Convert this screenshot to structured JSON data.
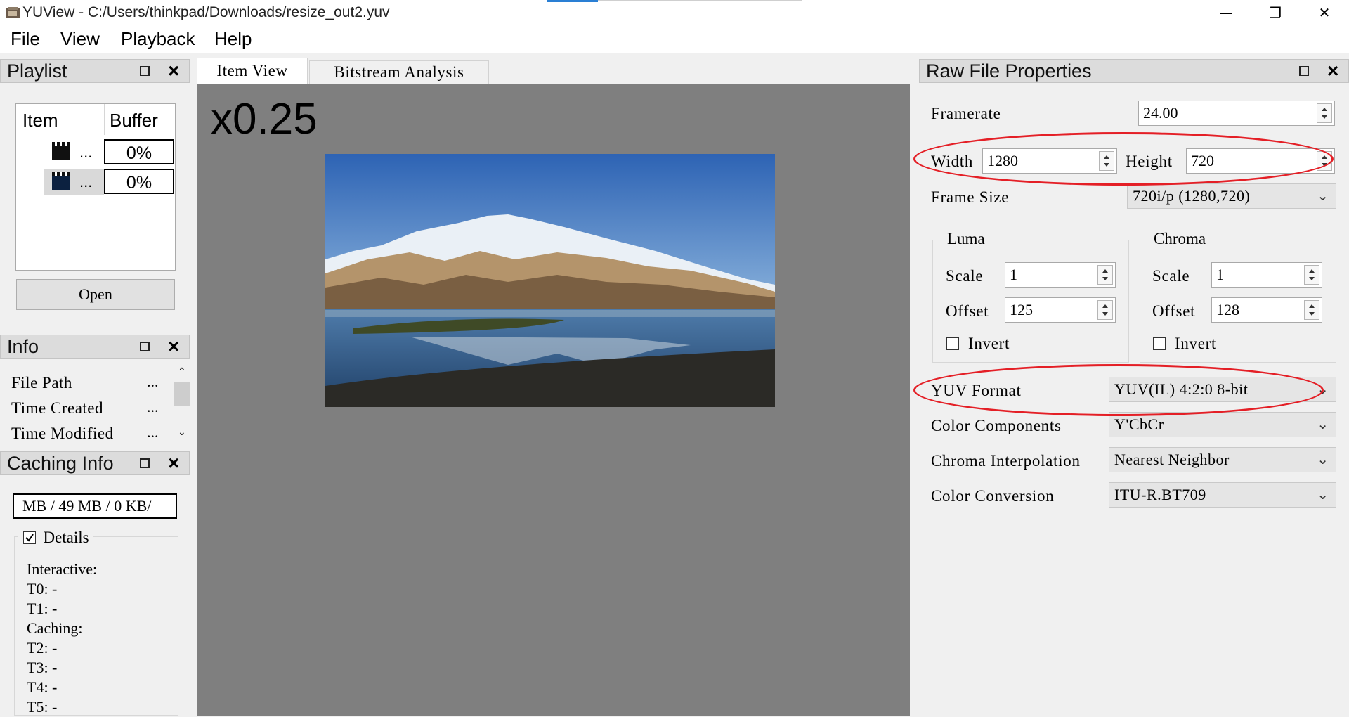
{
  "window": {
    "title": "YUView - C:/Users/thinkpad/Downloads/resize_out2.yuv",
    "minimize_symbol": "—",
    "restore_symbol": "❐",
    "close_symbol": "✕"
  },
  "menu": [
    "File",
    "View",
    "Playback",
    "Help"
  ],
  "playlist": {
    "title": "Playlist",
    "col_item": "Item",
    "col_buffer": "Buffer",
    "items": [
      {
        "name": "...",
        "buffer": "0%"
      },
      {
        "name": "...",
        "buffer": "0%"
      }
    ],
    "open_label": "Open"
  },
  "info": {
    "title": "Info",
    "rows": [
      {
        "label": "File Path",
        "value": "..."
      },
      {
        "label": "Time Created",
        "value": "..."
      },
      {
        "label": "Time Modified",
        "value": "..."
      }
    ]
  },
  "caching": {
    "title": "Caching Info",
    "summary": "MB / 49 MB / 0 KB/",
    "details_label": "Details",
    "details_checked": true,
    "lines": [
      "Interactive:",
      "T0: -",
      "T1: -",
      "Caching:",
      "T2: -",
      "T3: -",
      "T4: -",
      "T5: -"
    ]
  },
  "tabs": [
    "Item View",
    "Bitstream Analysis"
  ],
  "viewer": {
    "zoom": "x0.25"
  },
  "raw_props": {
    "title": "Raw File Properties",
    "framerate_label": "Framerate",
    "framerate": "24.00",
    "width_label": "Width",
    "width": "1280",
    "height_label": "Height",
    "height": "720",
    "frame_size_label": "Frame Size",
    "frame_size": "720i/p (1280,720)",
    "luma": {
      "title": "Luma",
      "scale_label": "Scale",
      "scale": "1",
      "offset_label": "Offset",
      "offset": "125",
      "invert_label": "Invert"
    },
    "chroma": {
      "title": "Chroma",
      "scale_label": "Scale",
      "scale": "1",
      "offset_label": "Offset",
      "offset": "128",
      "invert_label": "Invert"
    },
    "yuv_format_label": "YUV Format",
    "yuv_format": "YUV(IL) 4:2:0 8-bit",
    "color_components_label": "Color Components",
    "color_components": "Y'CbCr",
    "chroma_interp_label": "Chroma Interpolation",
    "chroma_interp": "Nearest Neighbor",
    "color_conversion_label": "Color Conversion",
    "color_conversion": "ITU-R.BT709"
  },
  "colors": {
    "highlight": "#e41f26",
    "viewer_bg": "#7f7f7f",
    "accent": "#2a7fd4"
  }
}
